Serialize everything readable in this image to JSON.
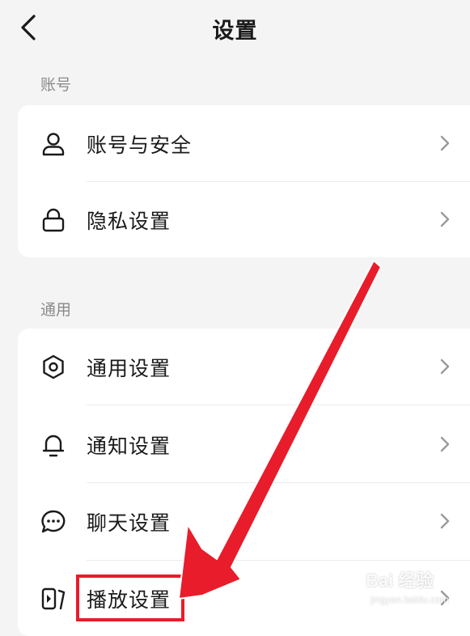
{
  "header": {
    "title": "设置"
  },
  "sections": [
    {
      "label": "账号",
      "items": [
        {
          "label": "账号与安全",
          "icon": "user-icon"
        },
        {
          "label": "隐私设置",
          "icon": "lock-icon"
        }
      ]
    },
    {
      "label": "通用",
      "items": [
        {
          "label": "通用设置",
          "icon": "gear-icon"
        },
        {
          "label": "通知设置",
          "icon": "bell-icon"
        },
        {
          "label": "聊天设置",
          "icon": "chat-bubble-icon"
        },
        {
          "label": "播放设置",
          "icon": "play-icon"
        }
      ]
    }
  ],
  "annotation": {
    "color": "#e81c2a",
    "highlighted_item": "播放设置"
  },
  "watermark": {
    "text": "Bai 经验",
    "sub": "jingyan.baidu.com"
  }
}
